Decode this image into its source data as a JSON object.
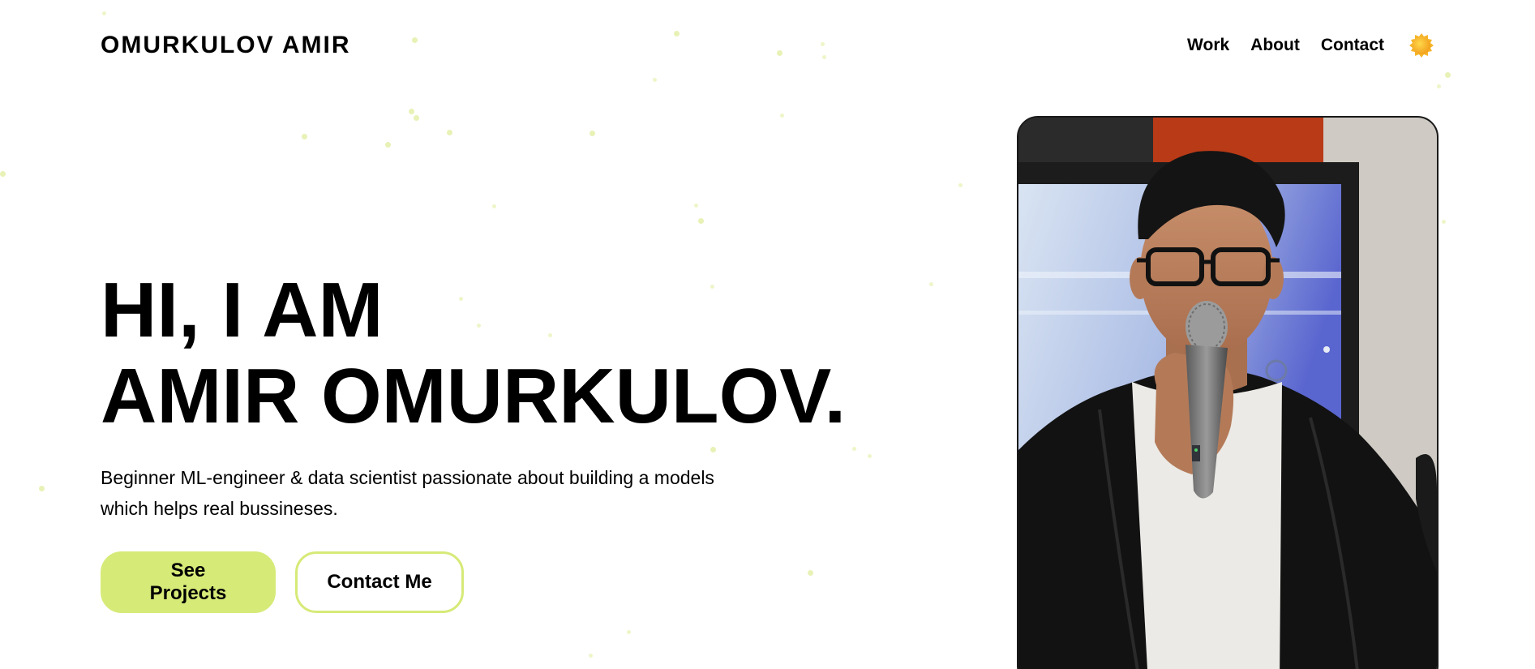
{
  "header": {
    "brand": "OMURKULOV AMIR",
    "nav": [
      {
        "label": "Work"
      },
      {
        "label": "About"
      },
      {
        "label": "Contact"
      }
    ],
    "theme_icon": "sun-icon"
  },
  "hero": {
    "title_line1": "HI, I AM",
    "title_line2": "AMIR OMURKULOV.",
    "subtitle_line1": "Beginner ML-engineer & data scientist passionate about building a models",
    "subtitle_line2": "which helps real bussineses.",
    "primary_button": "See Projects",
    "secondary_button": "Contact Me"
  },
  "colors": {
    "accent": "#d6ea78",
    "dot": "#e8f2b6",
    "text": "#000000",
    "background": "#ffffff"
  }
}
